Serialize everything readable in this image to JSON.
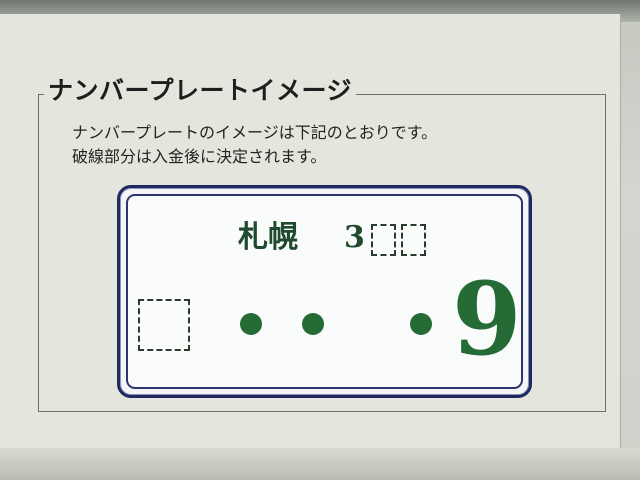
{
  "section": {
    "title": "ナンバープレートイメージ",
    "description_line1": "ナンバープレートのイメージは下記のとおりです。",
    "description_line2": "破線部分は入金後に決定されます。"
  },
  "plate": {
    "region": "札幌",
    "class_number_prefix": "3",
    "serial_digit": "9",
    "text_color": "#246b35",
    "border_color": "#1f2860",
    "placeholders": [
      "classification-digit-2",
      "classification-digit-3",
      "hiragana-character"
    ],
    "dots": [
      "•",
      "•",
      "•"
    ]
  }
}
